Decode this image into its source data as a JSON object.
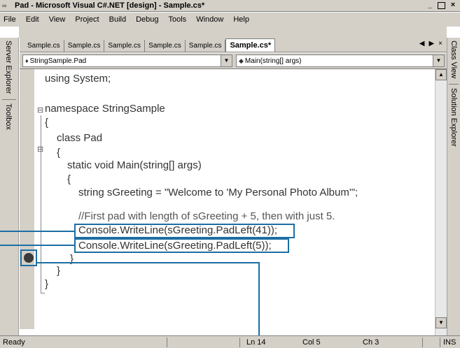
{
  "window": {
    "title": "Pad - Microsoft Visual C#.NET [design] - Sample.cs*",
    "buttons": [
      "_",
      " ",
      "×"
    ]
  },
  "menu": [
    "File",
    "Edit",
    "View",
    "Project",
    "Build",
    "Debug",
    "Tools",
    "Window",
    "Help"
  ],
  "left_sidebar": [
    "Server Explorer",
    "Toolbox"
  ],
  "right_sidebar": [
    "Class View",
    "Solution Explorer"
  ],
  "tabs": {
    "items": [
      "Sample.cs",
      "Sample.cs",
      "Sample.cs",
      "Sample.cs",
      "Sample.cs"
    ],
    "active": "Sample.cs*",
    "controls": [
      "◀",
      "▶",
      "×"
    ]
  },
  "dropdowns": {
    "class": "StringSample.Pad",
    "member": "Main(string[] args)"
  },
  "code": {
    "lines": [
      "using System;",
      "namespace StringSample",
      "{",
      "class Pad",
      "{",
      "static void Main(string[] args)",
      "{",
      "string sGreeting = \"Welcome to 'My Personal Photo Album'\";",
      "//First pad with length of sGreeting + 5, then with just 5.",
      "Console.WriteLine(sGreeting.PadLeft(41));",
      "Console.WriteLine(sGreeting.PadLeft(5));",
      "}",
      "}",
      "}"
    ]
  },
  "status": {
    "ready": "Ready",
    "ln": "Ln 14",
    "col": "Col 5",
    "ch": "Ch 3",
    "ins": "INS"
  }
}
